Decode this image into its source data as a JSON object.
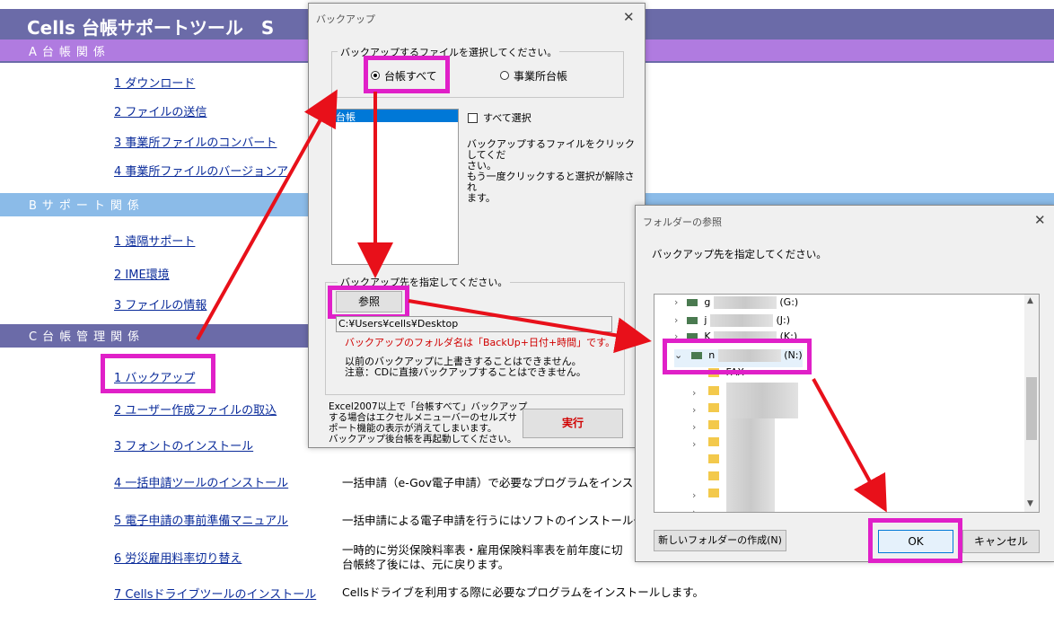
{
  "app": {
    "title": "Cells  台帳サポートツール　S",
    "sections": {
      "a": "A台帳関係",
      "b": "Bサポート関係",
      "c": "C台帳管理関係"
    },
    "menu_a": [
      "1  ダウンロード",
      "2  ファイルの送信",
      "3  事業所ファイルのコンバート",
      "4  事業所ファイルのバージョンア"
    ],
    "menu_b": [
      "1  遠隔サポート",
      "2  IME環境",
      "3  ファイルの情報"
    ],
    "menu_c": [
      "1  バックアップ",
      "2  ユーザー作成ファイルの取込",
      "3  フォントのインストール",
      "4  一括申請ツールのインストール",
      "5  電子申請の事前準備マニュアル",
      "6  労災雇用料率切り替え",
      "7  Cellsドライブツールのインストール"
    ],
    "descs": {
      "d4": "一括申請（e-Gov電子申請）で必要なプログラムをインスト",
      "d5": "一括申請による電子申請を行うにはソフトのインストールや",
      "d6a": "一時的に労災保険料率表・雇用保険料率表を前年度に切",
      "d6b": "台帳終了後には、元に戻ります。",
      "d7": "Cellsドライブを利用する際に必要なプログラムをインストールします。"
    }
  },
  "backup_dialog": {
    "title": "バックアップ",
    "file_group_label": "バックアップするファイルを選択してください。",
    "radio_all": "台帳すべて",
    "radio_office": "事業所台帳",
    "list_items": [
      "台帳"
    ],
    "select_all": "すべて選択",
    "hint_lines": [
      "バックアップするファイルをクリックしてくだ",
      "さい。",
      "もう一度クリックすると選択が解除され",
      "ます。"
    ],
    "dest_group_label": "バックアップ先を指定してください。",
    "browse_button": "参照",
    "path_value": "C:¥Users¥cells¥Desktop",
    "red_note": "バックアップのフォルダ名は「BackUp+日付+時間」です。",
    "notes": [
      "以前のバックアップに上書きすることはできません。",
      "注意：CDに直接バックアップすることはできません。"
    ],
    "excel_note": [
      "Excel2007以上で「台帳すべて」バックアップ",
      "する場合はエクセルメニューバーのセルズサ",
      "ポート機能の表示が消えてしまいます。",
      "バックアップ後台帳を再起動してください。"
    ],
    "run_button": "実行"
  },
  "folder_dialog": {
    "title": "フォルダーの参照",
    "prompt": "バックアップ先を指定してください。",
    "drives": [
      {
        "letter": "g",
        "suffix": "(G:)"
      },
      {
        "letter": "j",
        "suffix": "(J:)"
      },
      {
        "letter": "K",
        "suffix": "(K:)"
      },
      {
        "letter": "n",
        "suffix": "(N:)"
      }
    ],
    "first_folder": "FAX",
    "new_folder_button": "新しいフォルダーの作成(N)",
    "ok_button": "OK",
    "cancel_button": "キャンセル"
  },
  "colors": {
    "highlight": "#e020c8",
    "arrow": "#e8101a",
    "title_bar": "#6b6ba8",
    "selection": "#0078d7"
  }
}
